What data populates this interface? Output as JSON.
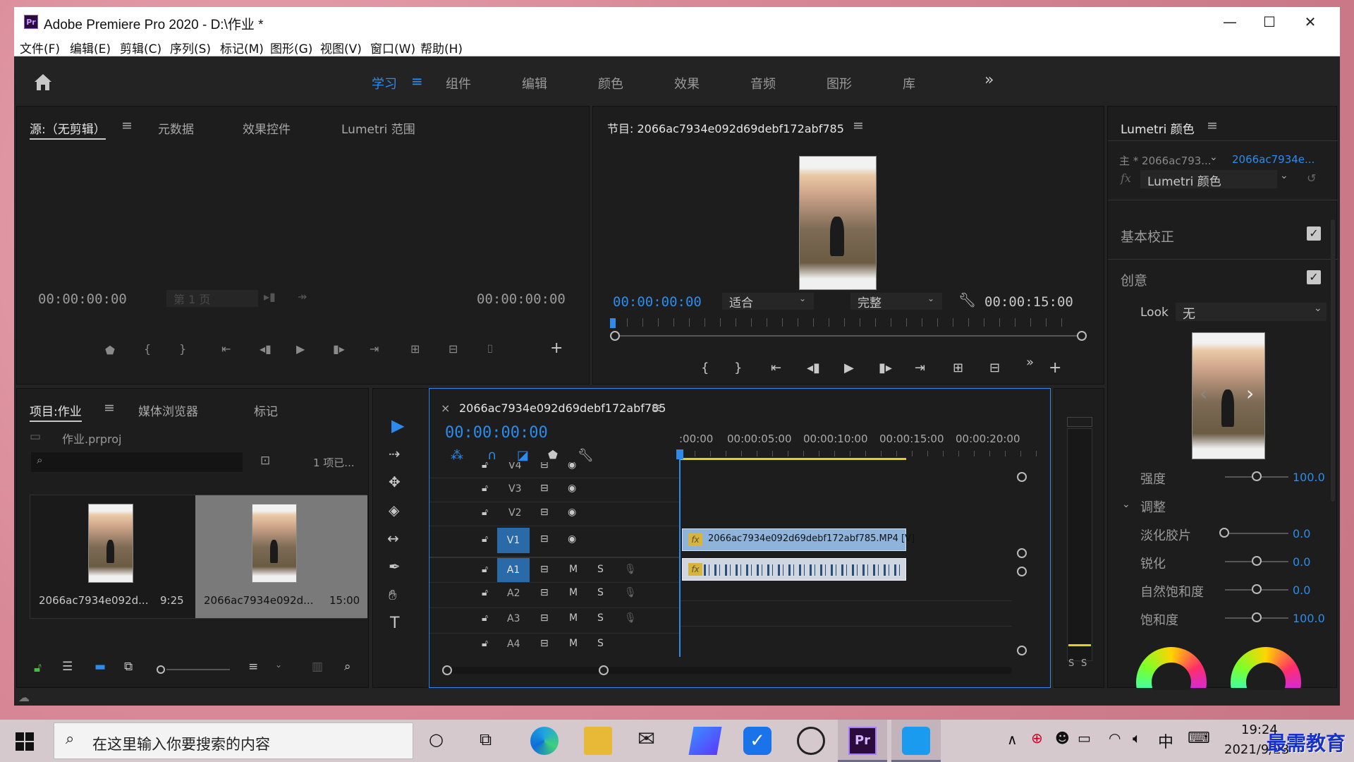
{
  "window": {
    "title": "Adobe Premiere Pro 2020 - D:\\作业 *",
    "app_icon": "Pr",
    "minimize": "—",
    "maximize": "☐",
    "close": "✕"
  },
  "menu": [
    "文件(F)",
    "编辑(E)",
    "剪辑(C)",
    "序列(S)",
    "标记(M)",
    "图形(G)",
    "视图(V)",
    "窗口(W)",
    "帮助(H)"
  ],
  "workspaces": {
    "items": [
      "学习",
      "组件",
      "编辑",
      "颜色",
      "效果",
      "音频",
      "图形",
      "库"
    ],
    "active": "学习",
    "more": "»"
  },
  "source_panel": {
    "tabs": [
      "源:（无剪辑）",
      "元数据",
      "效果控件",
      "Lumetri 范围"
    ],
    "tc_left": "00:00:00:00",
    "page": "第 1 页",
    "tc_right": "00:00:00:00"
  },
  "program_panel": {
    "title": "节目: 2066ac7934e092d69debf172abf785",
    "tc_current": "00:00:00:00",
    "fit": "适合",
    "quality": "完整",
    "tc_duration": "00:00:15:00"
  },
  "project_panel": {
    "tabs": [
      "项目:作业",
      "媒体浏览器",
      "标记"
    ],
    "file": "作业.prproj",
    "search_placeholder": "",
    "count": "1 项已...",
    "items": [
      {
        "name": "2066ac7934e092d...",
        "duration": "9:25"
      },
      {
        "name": "2066ac7934e092d...",
        "duration": "15:00"
      }
    ]
  },
  "timeline": {
    "tab_close": "×",
    "sequence": "2066ac7934e092d69debf172abf785",
    "tc": "00:00:00:00",
    "ruler": [
      ":00:00",
      "00:00:05:00",
      "00:00:10:00",
      "00:00:15:00",
      "00:00:20:00"
    ],
    "video_tracks": [
      "V4",
      "V3",
      "V2",
      "V1"
    ],
    "audio_tracks": [
      "A1",
      "A2",
      "A3",
      "A4"
    ],
    "m": "M",
    "s": "S",
    "clip_label": "2066ac7934e092d69debf172abf785.MP4 [V]",
    "fx": "fx"
  },
  "meter": {
    "s1": "S",
    "s2": "S"
  },
  "lumetri": {
    "title": "Lumetri 颜色",
    "master": "主 * 2066ac793...",
    "clip": "2066ac7934e...",
    "fx": "fx",
    "effect": "Lumetri 颜色",
    "basic": "基本校正",
    "creative": "创意",
    "look_label": "Look",
    "look_value": "无",
    "intensity_label": "强度",
    "intensity_value": "100.0",
    "adjust": "调整",
    "faded_label": "淡化胶片",
    "faded_value": "0.0",
    "sharpen_label": "锐化",
    "sharpen_value": "0.0",
    "vibrance_label": "自然饱和度",
    "vibrance_value": "0.0",
    "saturation_label": "饱和度",
    "saturation_value": "100.0"
  },
  "taskbar": {
    "search_placeholder": "在这里输入你要搜索的内容",
    "time": "19:24",
    "date": "2021/9/23",
    "ime": "中",
    "watermark": "最需教育"
  }
}
